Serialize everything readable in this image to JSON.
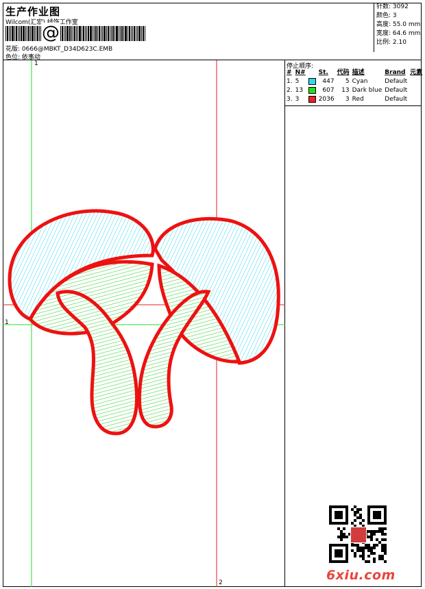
{
  "header": {
    "title": "生产作业图",
    "subtitle": "Wilcom(汇宏) 线饰工作室",
    "barcode_symbol": "@",
    "file_label": "花版:",
    "file_name": "0666@MBKT_D34D623C.EMB",
    "position_label": "色位:",
    "position_value": "依事动"
  },
  "stats": [
    {
      "label": "针数:",
      "value": "3092"
    },
    {
      "label": "颜色:",
      "value": "3"
    },
    {
      "label": "高度:",
      "value": "55.0 mm"
    },
    {
      "label": "宽度:",
      "value": "64.6 mm"
    },
    {
      "label": "比例:",
      "value": "2.10"
    }
  ],
  "canvas": {
    "marker_top": "1",
    "marker_left": "1",
    "marker_bottom": "2"
  },
  "stop_sequence": {
    "title": "停止顺序:",
    "columns": [
      "#",
      "N#",
      "",
      "St.",
      "代码",
      "描述",
      "Brand",
      "元素"
    ],
    "rows": [
      {
        "index": "1.",
        "needle": "5",
        "color": "#33d8ee",
        "stitches": "447",
        "code": "5",
        "description": "Cyan",
        "brand": "Default"
      },
      {
        "index": "2.",
        "needle": "13",
        "color": "#22dd22",
        "stitches": "607",
        "code": "13",
        "description": "Dark blue",
        "brand": "Default"
      },
      {
        "index": "3.",
        "needle": "3",
        "color": "#ee2222",
        "stitches": "2036",
        "code": "3",
        "description": "Red",
        "brand": "Default"
      }
    ]
  },
  "watermark": {
    "site": "6xiu.com"
  },
  "colors": {
    "cyan_thread": "#33d8ee",
    "green_thread": "#22cc22",
    "red_thread": "#ee1111",
    "guide_green": "#22dd22",
    "guide_red": "#dd2222"
  }
}
